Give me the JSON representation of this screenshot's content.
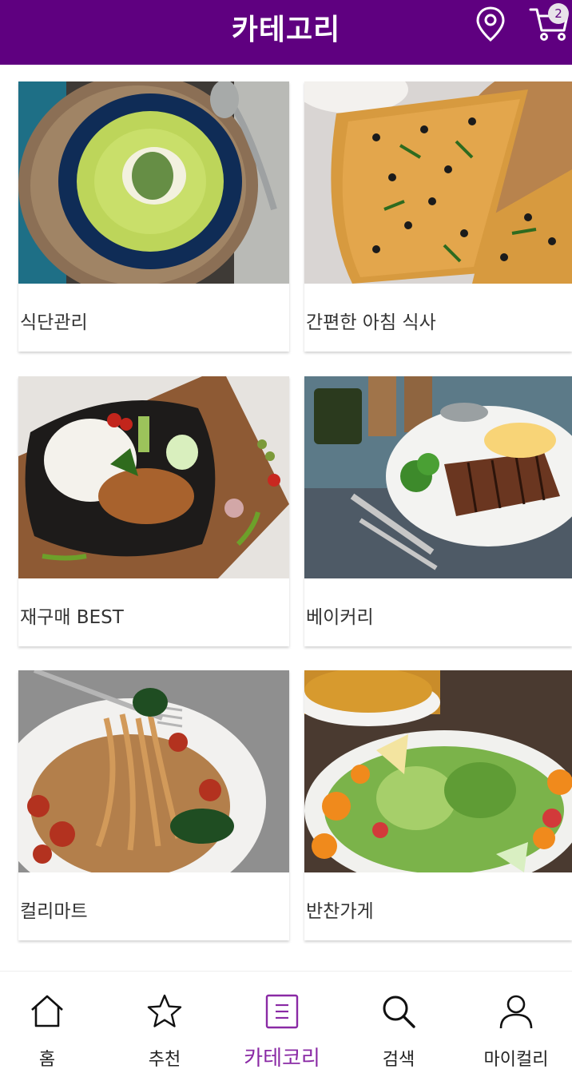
{
  "header": {
    "title": "카테고리",
    "location_icon": "location-pin-icon",
    "cart_icon": "cart-icon",
    "cart_count": "2"
  },
  "categories": [
    {
      "label": "식단관리",
      "image": "green-soup-bowl"
    },
    {
      "label": "간편한 아침 식사",
      "image": "olive-pizza"
    },
    {
      "label": "재구매 BEST",
      "image": "rice-basil-stirfry"
    },
    {
      "label": "베이커리",
      "image": "grilled-meat-plate"
    },
    {
      "label": "컬리마트",
      "image": "spaghetti-fork"
    },
    {
      "label": "반찬가게",
      "image": "fresh-salad"
    }
  ],
  "tabbar": {
    "items": [
      {
        "label": "홈",
        "icon": "home-icon"
      },
      {
        "label": "추천",
        "icon": "star-icon"
      },
      {
        "label": "카테코리",
        "icon": "category-list-icon",
        "active": true
      },
      {
        "label": "검색",
        "icon": "search-icon"
      },
      {
        "label": "마이컬리",
        "icon": "user-icon"
      }
    ]
  },
  "colors": {
    "brand": "#5f0080",
    "active_tab": "#8a2aa5"
  }
}
